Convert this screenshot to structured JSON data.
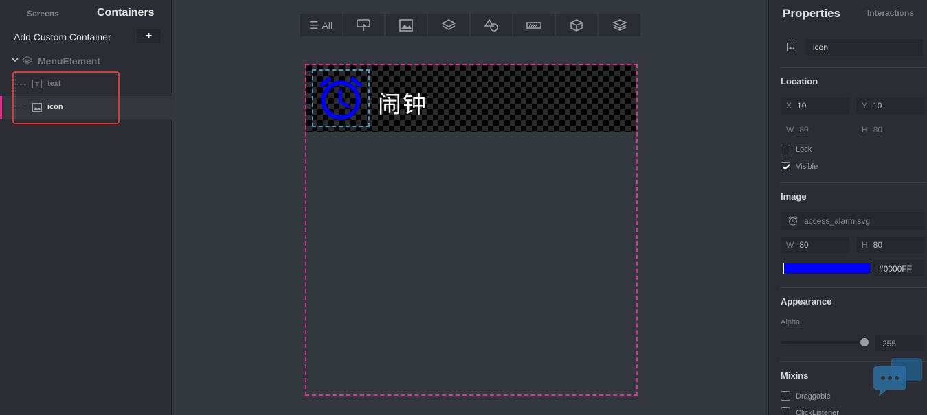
{
  "left_panel": {
    "tab_screens": "Screens",
    "tab_containers": "Containers",
    "add_container_label": "Add Custom Container",
    "add_button": "+",
    "tree": {
      "root": "MenuElement",
      "items": [
        {
          "label": "text",
          "icon": "text-type-icon",
          "selected": false
        },
        {
          "label": "icon",
          "icon": "image-icon",
          "selected": true
        }
      ]
    }
  },
  "toolbar": {
    "buttons": [
      {
        "label": "All",
        "icon": "list-icon"
      },
      {
        "label": "",
        "icon": "touch-button-icon"
      },
      {
        "label": "",
        "icon": "image-icon"
      },
      {
        "label": "",
        "icon": "layers-icon"
      },
      {
        "label": "",
        "icon": "shapes-icon"
      },
      {
        "label": "",
        "icon": "progress-bar-icon"
      },
      {
        "label": "",
        "icon": "cube-icon"
      },
      {
        "label": "",
        "icon": "stacked-layers-icon"
      }
    ]
  },
  "canvas": {
    "menu_text": "闹钟",
    "icon_color": "#0000FF",
    "selection_color": "#e0308a"
  },
  "right_panel": {
    "title": "Properties",
    "tab_interactions": "Interactions",
    "name_value": "icon",
    "location": {
      "title": "Location",
      "x_label": "X",
      "x_value": "10",
      "y_label": "Y",
      "y_value": "10",
      "w_label": "W",
      "w_value": "80",
      "h_label": "H",
      "h_value": "80",
      "lock_label": "Lock",
      "lock_checked": false,
      "visible_label": "Visible",
      "visible_checked": true
    },
    "image": {
      "title": "Image",
      "file": "access_alarm.svg",
      "w_label": "W",
      "w_value": "80",
      "h_label": "H",
      "h_value": "80",
      "color_hex": "#0000FF"
    },
    "appearance": {
      "title": "Appearance",
      "alpha_label": "Alpha",
      "alpha_value": "255",
      "alpha_level": 1.0
    },
    "mixins": {
      "title": "Mixins",
      "draggable_label": "Draggable",
      "clicklistener_label": "ClickListener"
    }
  }
}
